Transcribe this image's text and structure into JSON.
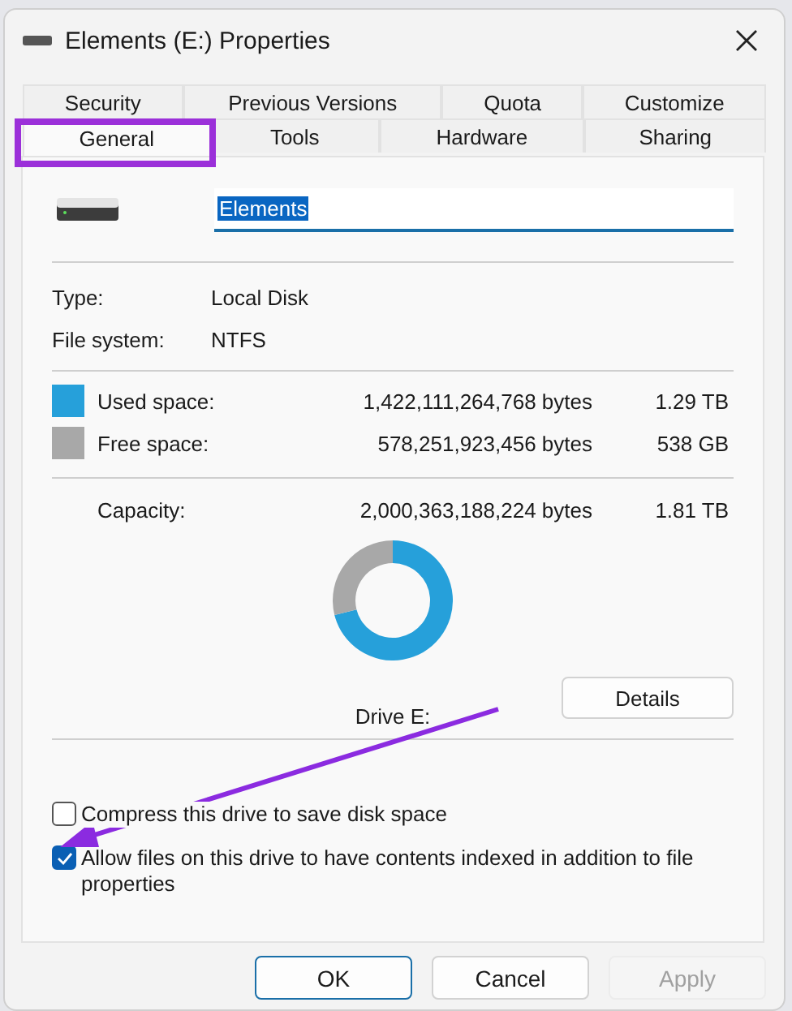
{
  "window": {
    "title": "Elements (E:) Properties"
  },
  "tabs": [
    [
      {
        "label": "Security",
        "selected": false
      },
      {
        "label": "Previous Versions",
        "selected": false
      },
      {
        "label": "Quota",
        "selected": false
      },
      {
        "label": "Customize",
        "selected": false
      }
    ],
    [
      {
        "label": "General",
        "selected": true
      },
      {
        "label": "Tools",
        "selected": false
      },
      {
        "label": "Hardware",
        "selected": false
      },
      {
        "label": "Sharing",
        "selected": false
      }
    ]
  ],
  "name_field": {
    "value": "Elements"
  },
  "info": [
    {
      "label": "Type:",
      "value": "Local Disk"
    },
    {
      "label": "File system:",
      "value": "NTFS"
    }
  ],
  "space": [
    {
      "label": "Used space:",
      "bytes": "1,422,111,264,768 bytes",
      "size": "1.29 TB",
      "color": "#26a0da"
    },
    {
      "label": "Free space:",
      "bytes": "578,251,923,456 bytes",
      "size": "538 GB",
      "color": "#a8a8a8"
    }
  ],
  "capacity": {
    "label": "Capacity:",
    "bytes": "2,000,363,188,224 bytes",
    "size": "1.81 TB"
  },
  "chart_data": {
    "type": "donut",
    "values": [
      71.1,
      28.9
    ]
  },
  "drive_label": "Drive E:",
  "details_button": "Details",
  "options": [
    {
      "label": "Compress this drive to save disk space",
      "checked": false
    },
    {
      "label": "Allow files on this drive to have contents indexed in addition to file properties",
      "checked": true
    }
  ],
  "buttons": [
    {
      "label": "OK",
      "kind": "default",
      "disabled": false
    },
    {
      "label": "Cancel",
      "kind": "normal",
      "disabled": false
    },
    {
      "label": "Apply",
      "kind": "normal",
      "disabled": true
    }
  ]
}
